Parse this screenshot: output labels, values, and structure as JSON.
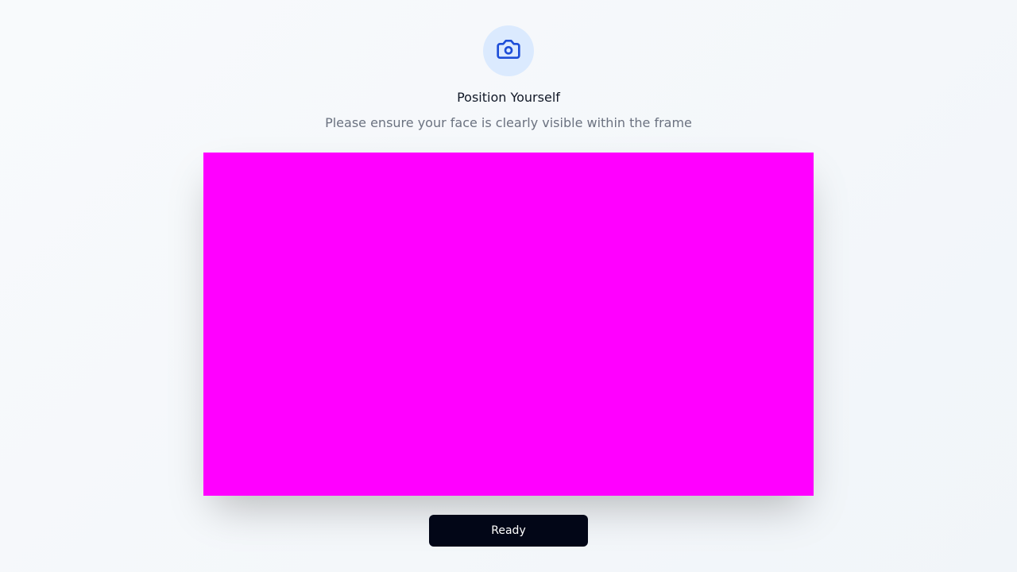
{
  "header": {
    "icon": "camera-icon",
    "icon_color": "#1d4ed8",
    "icon_bg": "#dbeafe",
    "title": "Position Yourself",
    "subtitle": "Please ensure your face is clearly visible within the frame"
  },
  "camera": {
    "feed_color": "#ff00ff"
  },
  "actions": {
    "ready_label": "Ready",
    "ready_bg": "#020617"
  }
}
